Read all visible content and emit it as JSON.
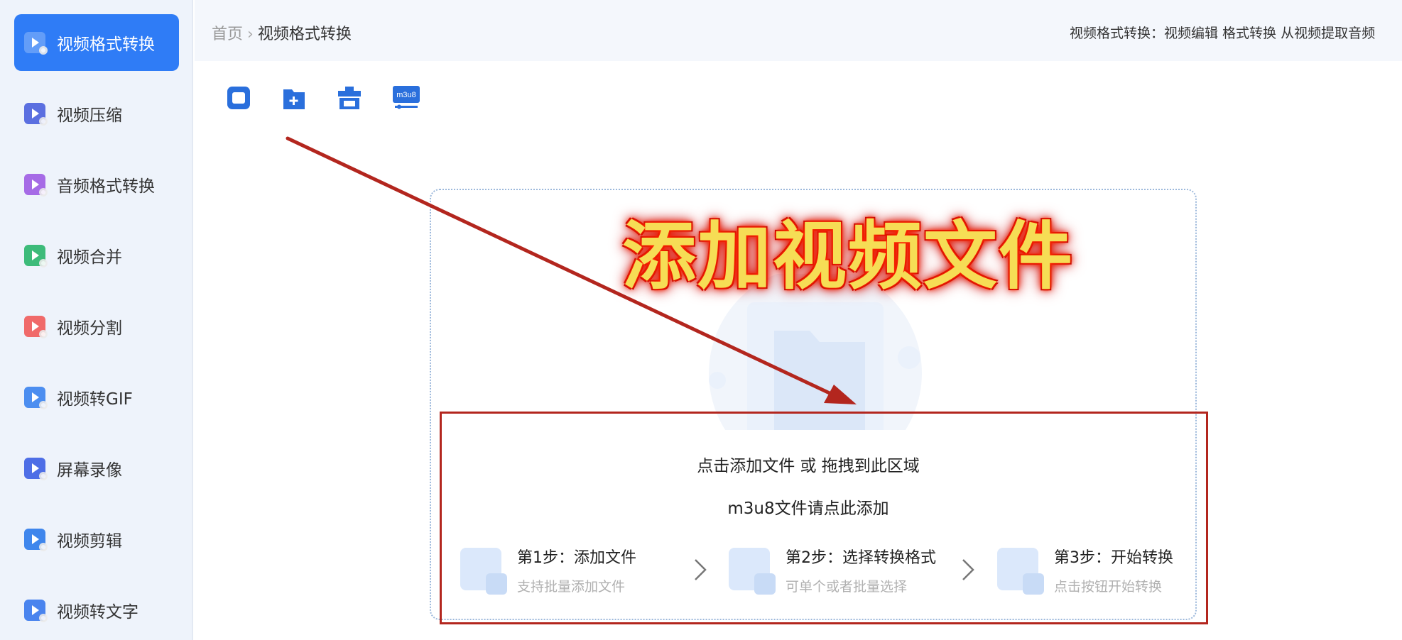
{
  "sidebar": {
    "items": [
      {
        "label": "视频格式转换",
        "icon": "video-convert-icon",
        "color": "#4aa2ff",
        "active": true
      },
      {
        "label": "视频压缩",
        "icon": "video-compress-icon",
        "color": "#5b6fe0"
      },
      {
        "label": "音频格式转换",
        "icon": "audio-convert-icon",
        "color": "#a66be6"
      },
      {
        "label": "视频合并",
        "icon": "video-merge-icon",
        "color": "#3dbb7a"
      },
      {
        "label": "视频分割",
        "icon": "video-split-icon",
        "color": "#f06a6a"
      },
      {
        "label": "视频转GIF",
        "icon": "video-gif-icon",
        "color": "#4c8ef0"
      },
      {
        "label": "屏幕录像",
        "icon": "screen-record-icon",
        "color": "#4e6ee6"
      },
      {
        "label": "视频剪辑",
        "icon": "video-edit-icon",
        "color": "#3f86ec"
      },
      {
        "label": "视频转文字",
        "icon": "video-to-text-icon",
        "color": "#4a84ee"
      }
    ]
  },
  "header": {
    "breadcrumb_home": "首页",
    "breadcrumb_sep": "›",
    "breadcrumb_current": "视频格式转换",
    "description": "视频格式转换：视频编辑 格式转换 从视频提取音频"
  },
  "toolbar": {
    "buttons": [
      {
        "icon": "add-file-icon"
      },
      {
        "icon": "add-folder-icon"
      },
      {
        "icon": "clear-list-icon"
      },
      {
        "icon": "m3u8-icon",
        "label": "m3u8"
      }
    ]
  },
  "dropzone": {
    "click_text": "点击添加文件 或 拖拽到此区域",
    "m3u8_text": "m3u8文件请点此添加",
    "steps": [
      {
        "title": "第1步：添加文件",
        "subtitle": "支持批量添加文件"
      },
      {
        "title": "第2步：选择转换格式",
        "subtitle": "可单个或者批量选择"
      },
      {
        "title": "第3步：开始转换",
        "subtitle": "点击按钮开始转换"
      }
    ]
  },
  "annotation": {
    "title": "添加视频文件",
    "arrow_color": "#b3261e",
    "title_color": "#f6dd55"
  },
  "colors": {
    "accent": "#2f7cf6",
    "sidebar_bg": "#eef3fb",
    "header_bg": "#f4f7fc"
  }
}
